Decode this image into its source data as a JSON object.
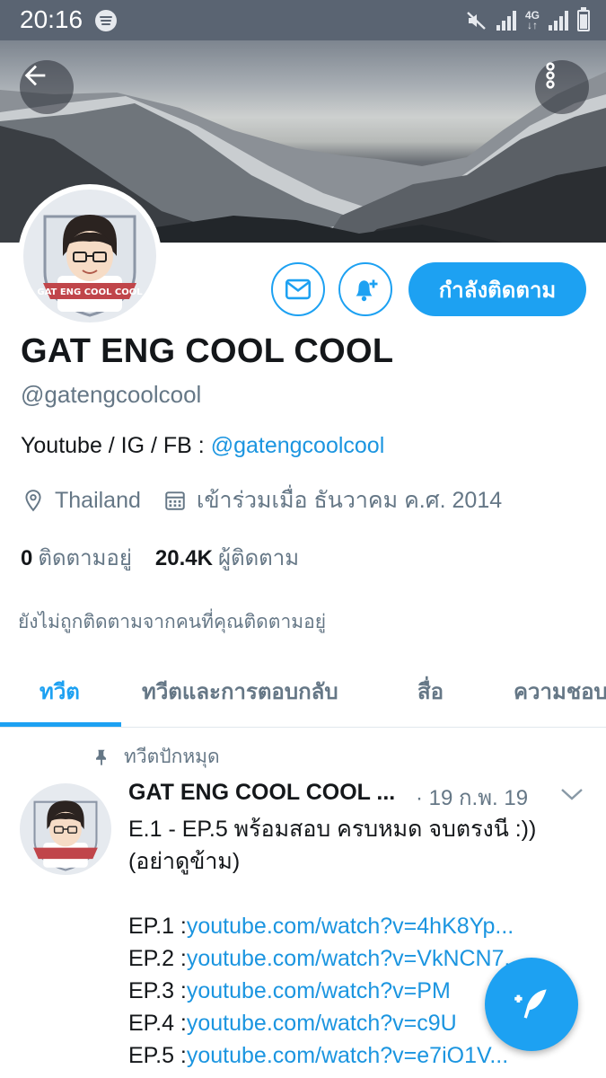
{
  "status_bar": {
    "time": "20:16",
    "network": "4G"
  },
  "profile": {
    "display_name": "GAT ENG COOL COOL",
    "handle": "@gatengcoolcool",
    "bio_prefix": "Youtube / IG / FB : ",
    "bio_link": "@gatengcoolcool",
    "location": "Thailand",
    "joined": "เข้าร่วมเมื่อ ธันวาคม ค.ศ. 2014",
    "following_count": "0",
    "following_label": "ติดตามอยู่",
    "followers_count": "20.4K",
    "followers_label": "ผู้ติดตาม",
    "not_followed_note": "ยังไม่ถูกติดตามจากคนที่คุณติดตามอยู่",
    "follow_button_label": "กำลังติดตาม",
    "avatar_text": "GAT ENG COOL COOL"
  },
  "tabs": [
    {
      "label": "ทวีต",
      "active": true
    },
    {
      "label": "ทวีตและการตอบกลับ",
      "active": false
    },
    {
      "label": "สื่อ",
      "active": false
    },
    {
      "label": "ความชอบ",
      "active": false
    }
  ],
  "tweet": {
    "pinned_label": "ทวีตปักหมุด",
    "author": "GAT ENG COOL COOL ...",
    "time": "· 19 ก.พ. 19",
    "text_line1": "E.1 - EP.5  พร้อมสอบ ครบหมด จบตรงนี :))",
    "text_line2": "(อย่าดูข้าม)",
    "episodes": [
      {
        "label": "EP.1 : ",
        "url": "youtube.com/watch?v=4hK8Yp..."
      },
      {
        "label": "EP.2 : ",
        "url": "youtube.com/watch?v=VkNCN7..."
      },
      {
        "label": "EP.3 : ",
        "url": "youtube.com/watch?v=PM"
      },
      {
        "label": "EP.4 : ",
        "url": "youtube.com/watch?v=c9U"
      },
      {
        "label": "EP.5 : ",
        "url": "youtube.com/watch?v=e7iO1V..."
      }
    ]
  },
  "colors": {
    "accent": "#1da1f2",
    "link": "#1b95e0",
    "muted": "#657786",
    "text": "#14171a",
    "status_bar": "#5a6472"
  },
  "icons": [
    "back-arrow-icon",
    "more-vertical-icon",
    "mail-icon",
    "bell-plus-icon",
    "location-pin-icon",
    "calendar-icon",
    "pin-icon",
    "chevron-down-icon",
    "compose-feather-icon"
  ]
}
